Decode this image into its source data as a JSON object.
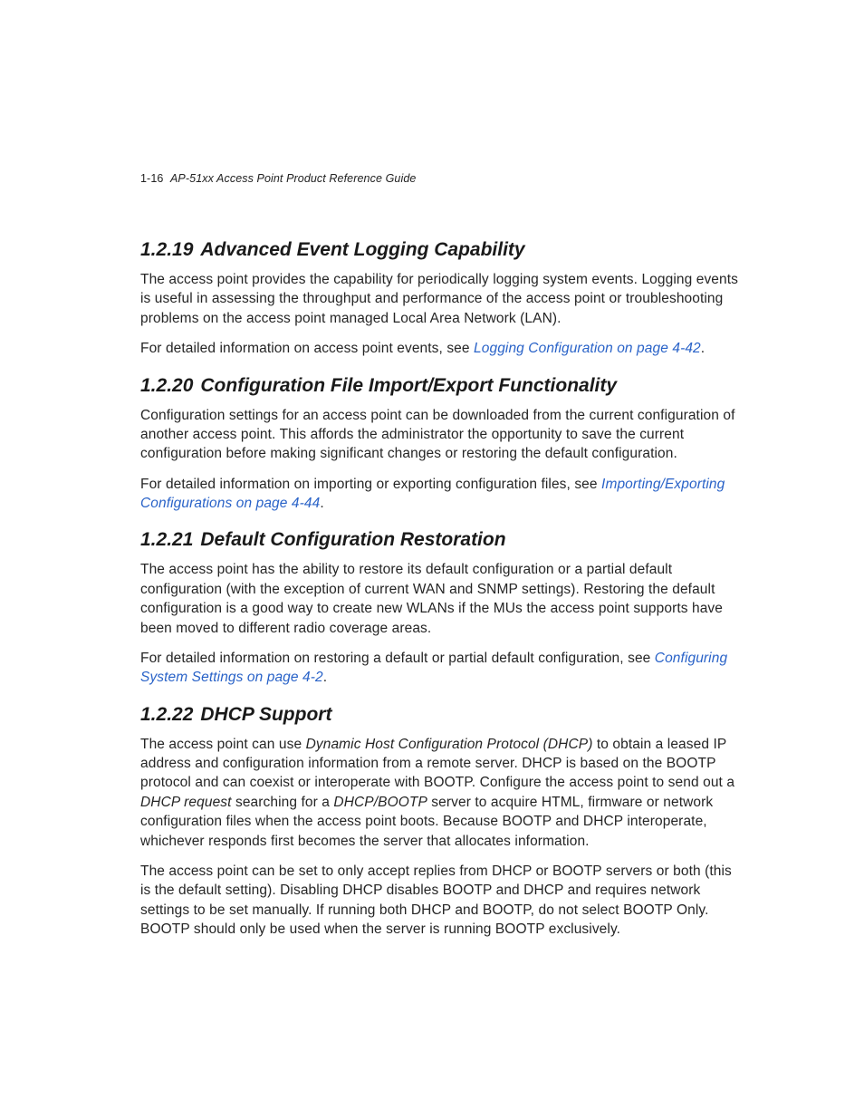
{
  "header": {
    "pagenum": "1-16",
    "guide": "AP-51xx Access Point Product Reference Guide"
  },
  "sections": [
    {
      "num": "1.2.19",
      "title": "Advanced Event Logging Capability",
      "p1": "The access point provides the capability for periodically logging system events. Logging events is useful in assessing the throughput and performance of the access point or troubleshooting problems on the access point managed Local Area Network (LAN).",
      "p2a": "For detailed information on access point events, see ",
      "p2link": "Logging Configuration on page 4-42",
      "p2b": "."
    },
    {
      "num": "1.2.20",
      "title": "Configuration File Import/Export Functionality",
      "p1": "Configuration settings for an access point can be downloaded from the current configuration of another access point. This affords the administrator the opportunity to save the current configuration before making significant changes or restoring the default configuration.",
      "p2a": "For detailed information on importing or exporting configuration files, see ",
      "p2link": "Importing/Exporting Configurations on page 4-44",
      "p2b": "."
    },
    {
      "num": "1.2.21",
      "title": "Default Configuration Restoration",
      "p1": "The access point has the ability to restore its default configuration or a partial default configuration (with the exception of current WAN and SNMP settings). Restoring the default configuration is a good way to create new WLANs if the MUs the access point supports have been moved to different radio coverage areas.",
      "p2a": "For detailed information on restoring a default or partial default configuration, see ",
      "p2link": "Configuring System Settings on page 4-2",
      "p2b": "."
    },
    {
      "num": "1.2.22",
      "title": "DHCP Support",
      "p1a": "The access point can use ",
      "p1i1": "Dynamic Host Configuration Protocol (DHCP)",
      "p1b": " to obtain a leased IP address and configuration information from a remote server. DHCP is based on the BOOTP protocol and can coexist or interoperate with BOOTP. Configure the access point to send out a ",
      "p1i2": "DHCP request",
      "p1c": " searching for a ",
      "p1i3": "DHCP/BOOTP",
      "p1d": " server to acquire HTML, firmware or network configuration files when the access point boots. Because BOOTP and DHCP interoperate, whichever responds first becomes the server that allocates information.",
      "p2": "The access point can be set to only accept replies from DHCP or BOOTP servers or both (this is the default setting). Disabling DHCP disables BOOTP and DHCP and requires network settings to be set manually. If running both DHCP and BOOTP, do not select BOOTP Only. BOOTP should only be used when the server is running BOOTP exclusively."
    }
  ]
}
